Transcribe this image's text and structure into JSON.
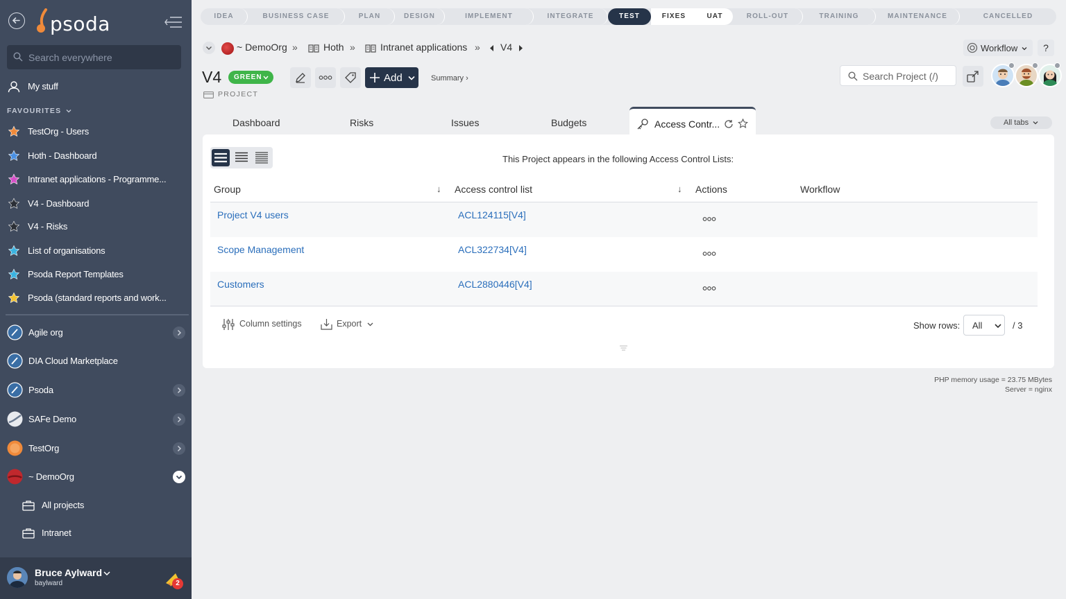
{
  "sidebar": {
    "logo": "psoda",
    "search_placeholder": "Search everywhere",
    "my_stuff": "My stuff",
    "favourites_heading": "FAVOURITES",
    "favourites": [
      {
        "label": "TestOrg - Users",
        "color": "#f08a3a"
      },
      {
        "label": "Hoth - Dashboard",
        "color": "#4a90e2"
      },
      {
        "label": "Intranet applications - Programme...",
        "color": "#d64fc8"
      },
      {
        "label": "V4 - Dashboard",
        "color": "#2b2f36"
      },
      {
        "label": "V4 - Risks",
        "color": "#2b2f36"
      },
      {
        "label": "List of organisations",
        "color": "#3bb3e0"
      },
      {
        "label": "Psoda Report Templates",
        "color": "#3bb3e0"
      },
      {
        "label": "Psoda (standard reports and work...",
        "color": "#f2c230"
      }
    ],
    "orgs": [
      {
        "label": "Agile org",
        "expandable": true
      },
      {
        "label": "DIA Cloud Marketplace",
        "expandable": false
      },
      {
        "label": "Psoda",
        "expandable": true
      },
      {
        "label": "SAFe Demo",
        "expandable": true
      },
      {
        "label": "TestOrg",
        "expandable": true
      },
      {
        "label": "~ DemoOrg",
        "expandable": true
      }
    ],
    "sub_items": [
      "All projects",
      "Intranet"
    ],
    "user": {
      "name": "Bruce Aylward",
      "handle": "baylward",
      "notifications": "2"
    }
  },
  "stages": [
    "IDEA",
    "BUSINESS CASE",
    "PLAN",
    "DESIGN",
    "IMPLEMENT",
    "INTEGRATE",
    "TEST",
    "FIXES",
    "UAT",
    "ROLL-OUT",
    "TRAINING",
    "MAINTENANCE",
    "CANCELLED"
  ],
  "active_stage": "TEST",
  "breadcrumb": {
    "org": "~ DemoOrg",
    "items": [
      "Hoth",
      "Intranet applications",
      "V4"
    ]
  },
  "header": {
    "workflow_label": "Workflow",
    "help_label": "?",
    "title": "V4",
    "status": "GREEN",
    "type": "PROJECT",
    "add_label": "Add",
    "summary_link": "Summary ›",
    "search_placeholder": "Search Project (/)"
  },
  "tabs": [
    "Dashboard",
    "Risks",
    "Issues",
    "Budgets"
  ],
  "active_tab": "Access Contr...",
  "all_tabs_label": "All tabs",
  "table": {
    "message": "This Project appears in the following Access Control Lists:",
    "headers": [
      "Group",
      "Access control list",
      "Actions",
      "Workflow"
    ],
    "rows": [
      {
        "group": "Project V4 users",
        "acl": "ACL124115[V4]"
      },
      {
        "group": "Scope Management",
        "acl": "ACL322734[V4]"
      },
      {
        "group": "Customers",
        "acl": "ACL2880446[V4]"
      }
    ],
    "column_settings": "Column settings",
    "export": "Export",
    "show_rows_label": "Show rows:",
    "show_rows_value": "All",
    "total": "/ 3"
  },
  "footer": {
    "memory": "PHP memory usage = 23.75 MBytes",
    "server": "Server = nginx"
  },
  "colors": {
    "sidebar": "#404b5e",
    "accent": "#263449",
    "status_green": "#3fb549",
    "link": "#2a6ebb"
  }
}
